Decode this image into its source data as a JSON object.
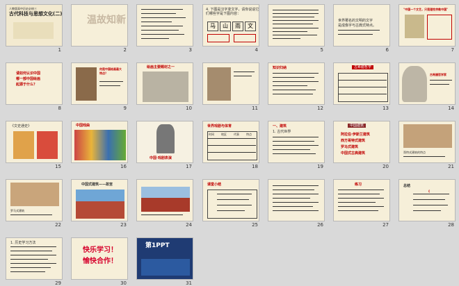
{
  "slides": [
    {
      "n": "1",
      "t1": "人教版高中历史必修三",
      "t2": "古代科技与思想文化(二)"
    },
    {
      "n": "2",
      "t1": "温故知新"
    },
    {
      "n": "3"
    },
    {
      "n": "4",
      "t1": "4. 下图是汉字变文字，请你说说它",
      "t2": "们哪些字是下图内容：",
      "chars": [
        "马",
        "山",
        "雨",
        "文"
      ]
    },
    {
      "n": "5"
    },
    {
      "n": "6",
      "t1": "世界著名的文明的文字",
      "t2": "是成像字与古典式特点。"
    },
    {
      "n": "7",
      "t1": "\"中国一个文艺，只是理性宗教中国\""
    },
    {
      "n": "8",
      "t1": "请如何认识中国",
      "t2": "哪一部中国绘画",
      "t3": "起源于什么？"
    },
    {
      "n": "9",
      "t1": "何是中国绘画最大",
      "t2": "特点？"
    },
    {
      "n": "10",
      "t1": "绘画主要题材之一"
    },
    {
      "n": "11"
    },
    {
      "n": "12",
      "t1": "知识归纳"
    },
    {
      "n": "13",
      "t1": "古希腊哲学",
      "t2": "苏格拉底"
    },
    {
      "n": "14",
      "t1": "古希腊哲学家"
    },
    {
      "n": "15",
      "t1": "《文史通史》",
      "t2": "文化·一本书"
    },
    {
      "n": "16",
      "t1": "中国戏曲"
    },
    {
      "n": "17",
      "t1": "中国·戏剧表演"
    },
    {
      "n": "18",
      "t1": "世界戏剧与体育",
      "headers": [
        "时间",
        "地区",
        "代表",
        "特点"
      ]
    },
    {
      "n": "19",
      "t1": "一、建筑",
      "t2": "1. 古代世界"
    },
    {
      "n": "20",
      "t1": "中国建筑",
      "items": [
        "阿拉伯·伊斯兰建筑",
        "西方哥特式建筑",
        "罗马式建筑",
        "中国式古典建筑"
      ]
    },
    {
      "n": "21",
      "t1": "哥特式建筑的特点"
    },
    {
      "n": "22",
      "t1": "罗马式建筑"
    },
    {
      "n": "23",
      "t1": "中国式建筑——故宫"
    },
    {
      "n": "24"
    },
    {
      "n": "25",
      "t1": "课堂小结"
    },
    {
      "n": "26"
    },
    {
      "n": "27",
      "t1": "练习"
    },
    {
      "n": "28",
      "t1": "总结"
    },
    {
      "n": "29",
      "t1": "1. 历史学习方法"
    },
    {
      "n": "30",
      "t1": "快乐学习！",
      "t2": "愉快合作！"
    },
    {
      "n": "31",
      "t1": "第1PPT"
    }
  ]
}
